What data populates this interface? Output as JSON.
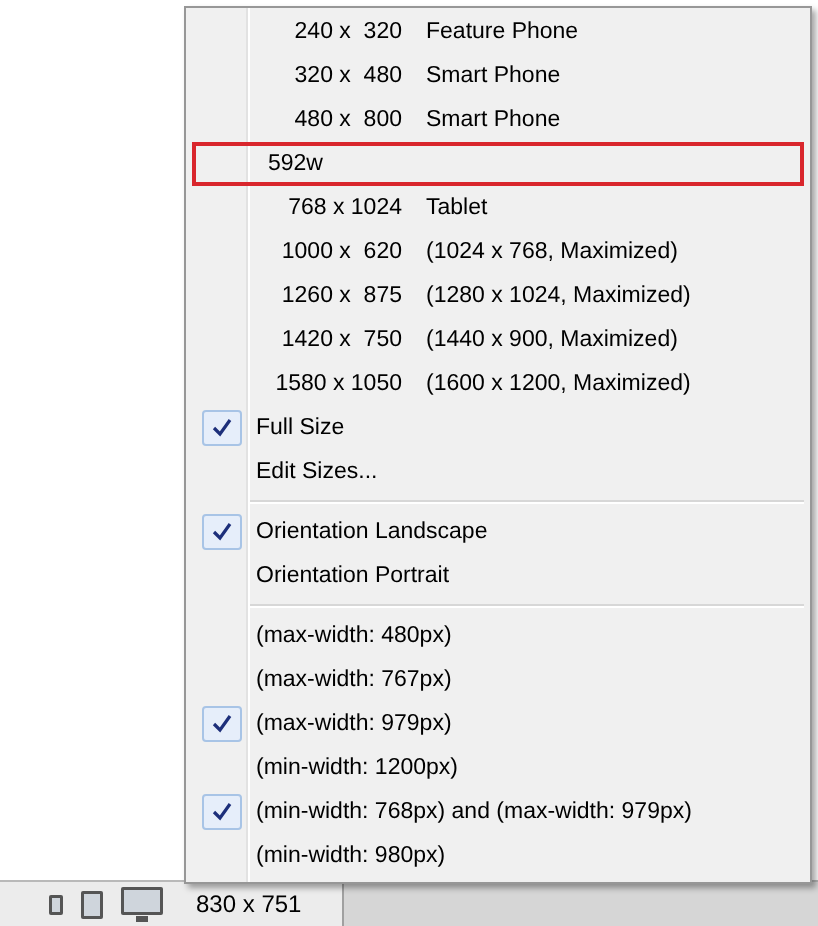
{
  "menu": {
    "sections": [
      {
        "items": [
          {
            "kind": "size",
            "size": "240 x  320",
            "label": "Feature Phone",
            "highlighted": false
          },
          {
            "kind": "size",
            "size": "320 x  480",
            "label": "Smart Phone",
            "highlighted": false
          },
          {
            "kind": "size",
            "size": "480 x  800",
            "label": "Smart Phone",
            "highlighted": false
          },
          {
            "kind": "size",
            "size": "592w",
            "highlighted": true
          },
          {
            "kind": "size",
            "size": "768 x 1024",
            "label": "Tablet",
            "highlighted": false
          },
          {
            "kind": "size",
            "size": "1000 x  620",
            "label": "(1024 x 768, Maximized)",
            "highlighted": false
          },
          {
            "kind": "size",
            "size": "1260 x  875",
            "label": "(1280 x 1024, Maximized)",
            "highlighted": false
          },
          {
            "kind": "size",
            "size": "1420 x  750",
            "label": "(1440 x 900, Maximized)",
            "highlighted": false
          },
          {
            "kind": "size",
            "size": "1580 x 1050",
            "label": "(1600 x 1200, Maximized)",
            "highlighted": false
          },
          {
            "kind": "option",
            "label": "Full Size",
            "checked": true
          },
          {
            "kind": "option",
            "label": "Edit Sizes...",
            "checked": false
          }
        ]
      },
      {
        "items": [
          {
            "kind": "option",
            "label": "Orientation Landscape",
            "checked": true
          },
          {
            "kind": "option",
            "label": "Orientation Portrait",
            "checked": false
          }
        ]
      },
      {
        "items": [
          {
            "kind": "option",
            "label": "(max-width: 480px)",
            "checked": false
          },
          {
            "kind": "option",
            "label": "(max-width: 767px)",
            "checked": false
          },
          {
            "kind": "option",
            "label": "(max-width: 979px)",
            "checked": true
          },
          {
            "kind": "option",
            "label": "(min-width: 1200px)",
            "checked": false
          },
          {
            "kind": "option",
            "label": "(min-width: 768px) and (max-width: 979px)",
            "checked": true
          },
          {
            "kind": "option",
            "label": "(min-width: 980px)",
            "checked": false
          }
        ]
      }
    ]
  },
  "status_bar": {
    "size": "830 x 751"
  }
}
